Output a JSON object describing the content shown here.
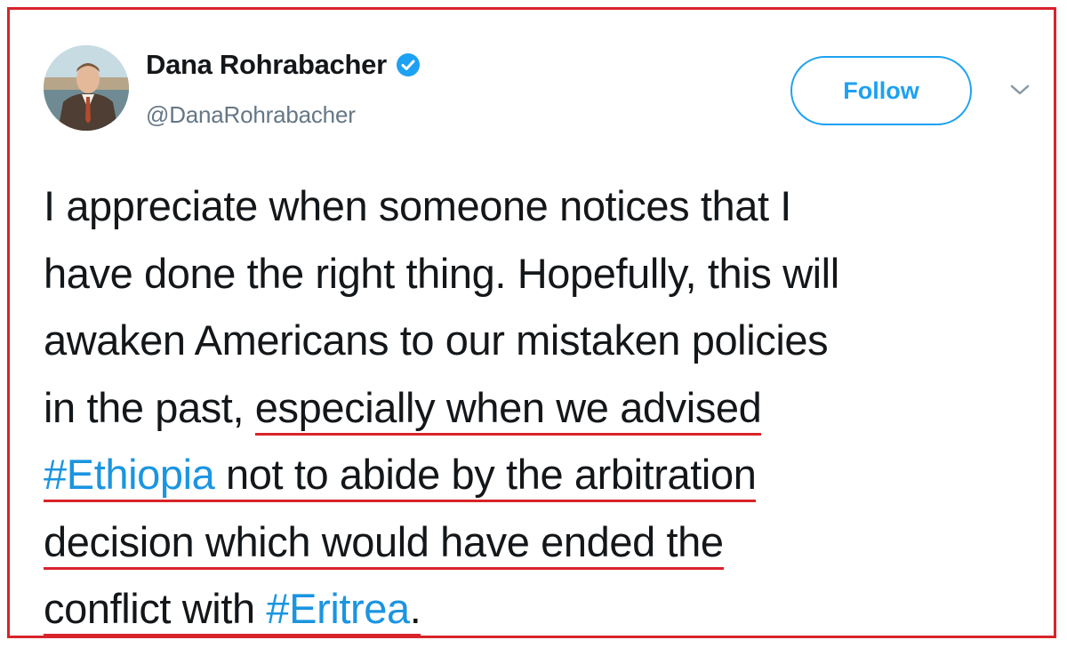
{
  "author": {
    "display_name": "Dana Rohrabacher",
    "handle": "@DanaRohrabacher",
    "verified": true,
    "avatar_icon": "profile-photo"
  },
  "actions": {
    "follow_label": "Follow",
    "menu_icon": "chevron-down-icon"
  },
  "tweet": {
    "lines": [
      [
        "I appreciate when someone notices that I"
      ],
      [
        "have done the right thing. Hopefully, this will"
      ],
      [
        "awaken Americans to our mistaken policies"
      ],
      [
        "in the past, ",
        "especially when we advised"
      ],
      [
        "#Ethiopia",
        " not to abide by the arbitration"
      ],
      [
        "decision which would have ended the"
      ],
      [
        "conflict with ",
        "#Eritrea",
        "."
      ]
    ]
  },
  "colors": {
    "link": "#1b95e0",
    "follow_border": "#1da1f2",
    "verified_badge": "#1da1f2",
    "highlight_underline": "#d8232a",
    "frame_border": "#d8232a",
    "text": "#14171a",
    "secondary_text": "#657786"
  }
}
